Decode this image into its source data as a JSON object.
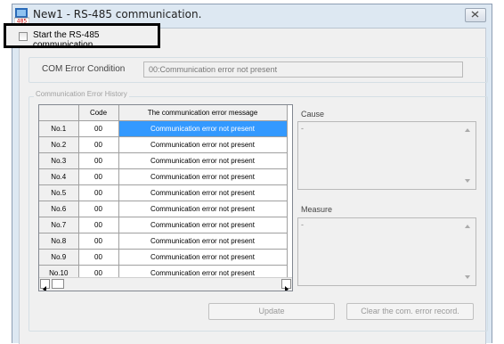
{
  "window": {
    "title": "New1 - RS-485 communication.",
    "icon": "app-485-icon"
  },
  "start": {
    "label": "Start the RS-485 communication.",
    "checked": false
  },
  "com_error": {
    "label": "COM Error Condition",
    "value": "00:Communication error not present"
  },
  "history": {
    "legend": "Communication Error History",
    "columns": [
      "",
      "Code",
      "The communication error message"
    ],
    "rows": [
      {
        "no": "No.1",
        "code": "00",
        "message": "Communication error not present"
      },
      {
        "no": "No.2",
        "code": "00",
        "message": "Communication error not present"
      },
      {
        "no": "No.3",
        "code": "00",
        "message": "Communication error not present"
      },
      {
        "no": "No.4",
        "code": "00",
        "message": "Communication error not present"
      },
      {
        "no": "No.5",
        "code": "00",
        "message": "Communication error not present"
      },
      {
        "no": "No.6",
        "code": "00",
        "message": "Communication error not present"
      },
      {
        "no": "No.7",
        "code": "00",
        "message": "Communication error not present"
      },
      {
        "no": "No.8",
        "code": "00",
        "message": "Communication error not present"
      },
      {
        "no": "No.9",
        "code": "00",
        "message": "Communication error not present"
      },
      {
        "no": "No.10",
        "code": "00",
        "message": "Communication error not present"
      }
    ],
    "selected_row": 0
  },
  "cause": {
    "label": "Cause",
    "value": "-"
  },
  "measure": {
    "label": "Measure",
    "value": "-"
  },
  "buttons": {
    "update": "Update",
    "clear": "Clear the com. error record."
  },
  "colors": {
    "selection": "#3399ff",
    "window_frame": "#dde8f2",
    "client_bg": "#f0f0f0"
  }
}
